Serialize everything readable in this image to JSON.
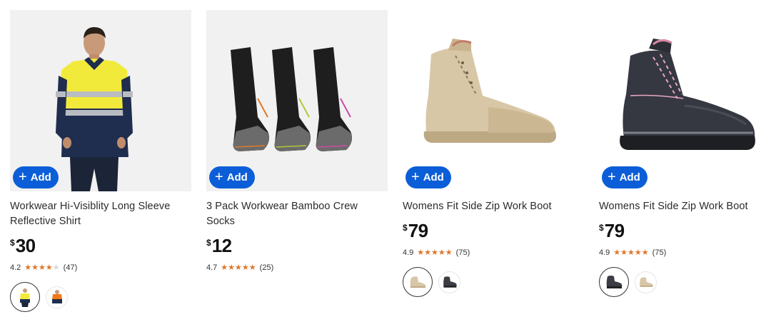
{
  "products": [
    {
      "title": "Workwear Hi-Visiblity Long Sleeve Reflective Shirt",
      "currency": "$",
      "price": "30",
      "rating_value": "4.2",
      "rating_stars": 4.2,
      "review_count": "(47)",
      "add_label": "Add",
      "image_icon": "hi-vis-shirt-icon",
      "swatches": [
        "yellow-navy-shirt-icon",
        "orange-navy-shirt-icon"
      ]
    },
    {
      "title": "3 Pack Workwear Bamboo Crew Socks",
      "currency": "$",
      "price": "12",
      "rating_value": "4.7",
      "rating_stars": 4.7,
      "review_count": "(25)",
      "add_label": "Add",
      "image_icon": "socks-icon",
      "swatches": []
    },
    {
      "title": "Womens Fit Side Zip Work Boot",
      "currency": "$",
      "price": "79",
      "rating_value": "4.9",
      "rating_stars": 4.9,
      "review_count": "(75)",
      "add_label": "Add",
      "image_icon": "tan-boot-icon",
      "swatches": [
        "tan-boot-icon",
        "black-boot-icon"
      ]
    },
    {
      "title": "Womens Fit Side Zip Work Boot",
      "currency": "$",
      "price": "79",
      "rating_value": "4.9",
      "rating_stars": 4.9,
      "review_count": "(75)",
      "add_label": "Add",
      "image_icon": "black-boot-icon",
      "swatches": [
        "black-boot-icon",
        "tan-boot-icon"
      ]
    }
  ],
  "colors": {
    "add_button": "#0b5ed7",
    "star": "#e0762a",
    "star_empty": "#d7d7d7"
  }
}
